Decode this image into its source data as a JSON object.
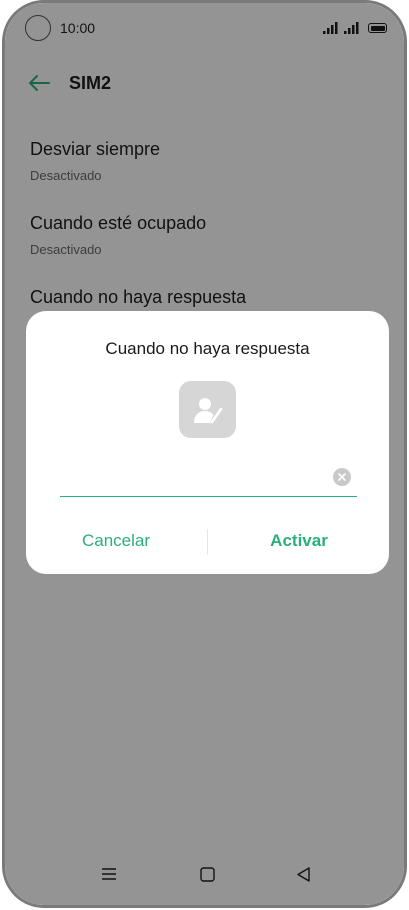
{
  "status_bar": {
    "time": "10:00",
    "icons": [
      "signal-icon",
      "signal-icon",
      "battery-icon"
    ]
  },
  "header": {
    "title": "SIM2",
    "back_icon": "arrow-left-icon"
  },
  "settings": [
    {
      "title": "Desviar siempre",
      "subtitle": "Desactivado"
    },
    {
      "title": "Cuando esté ocupado",
      "subtitle": "Desactivado"
    },
    {
      "title": "Cuando no haya respuesta",
      "subtitle": ""
    }
  ],
  "dialog": {
    "title": "Cuando no haya respuesta",
    "contact_icon": "contact-picker-icon",
    "input_value": "",
    "clear_icon": "clear-icon",
    "cancel_label": "Cancelar",
    "activate_label": "Activar"
  },
  "nav_bar": {
    "items": [
      "menu-icon",
      "home-icon",
      "back-triangle-icon"
    ]
  },
  "colors": {
    "accent": "#2ab07a",
    "scrim": "rgba(0,0,0,0.42)",
    "contact_bg": "#d6d6d6"
  }
}
